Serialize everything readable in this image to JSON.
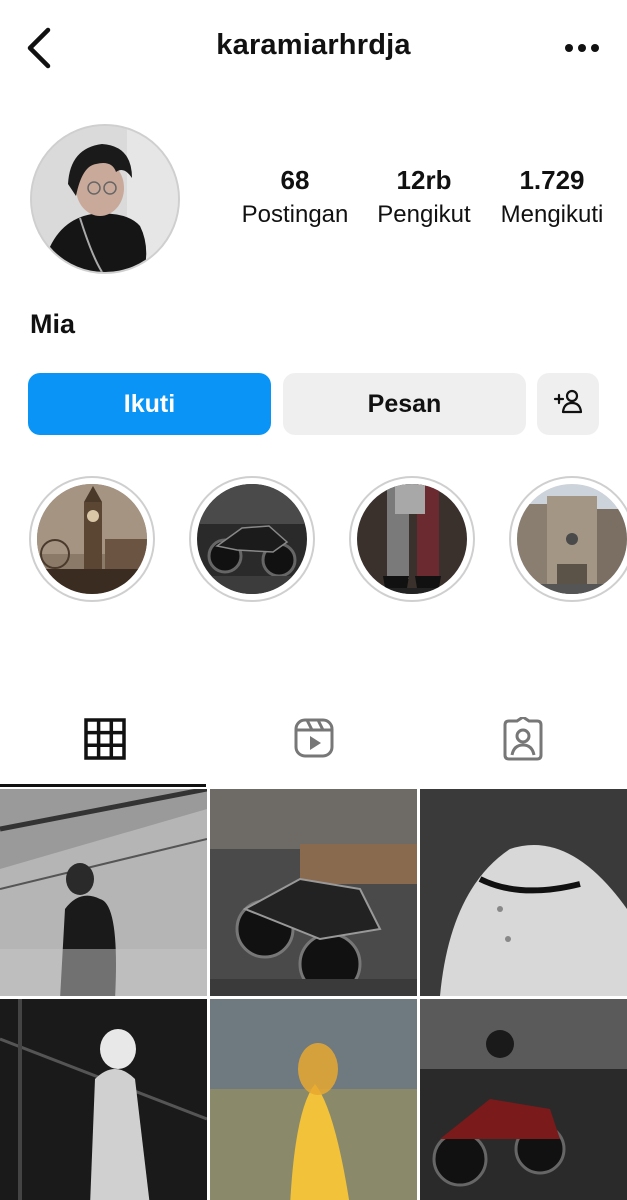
{
  "header": {
    "username": "karamiarhrdja"
  },
  "profile": {
    "display_name": "Mia",
    "stats": [
      {
        "value": "68",
        "label": "Postingan"
      },
      {
        "value": "12rb",
        "label": "Pengikut"
      },
      {
        "value": "1.729",
        "label": "Mengikuti"
      }
    ]
  },
  "actions": {
    "follow_label": "Ikuti",
    "message_label": "Pesan"
  },
  "highlights": [
    {
      "icon": "clock-tower-photo"
    },
    {
      "icon": "motorcycle-photo"
    },
    {
      "icon": "legs-stockings-photo"
    },
    {
      "icon": "city-building-photo"
    }
  ],
  "tabs": [
    {
      "icon": "grid-icon",
      "active": true
    },
    {
      "icon": "reels-icon",
      "active": false
    },
    {
      "icon": "tagged-icon",
      "active": false
    }
  ],
  "colors": {
    "accent": "#0a95f6",
    "secondary_button": "#efefef"
  }
}
